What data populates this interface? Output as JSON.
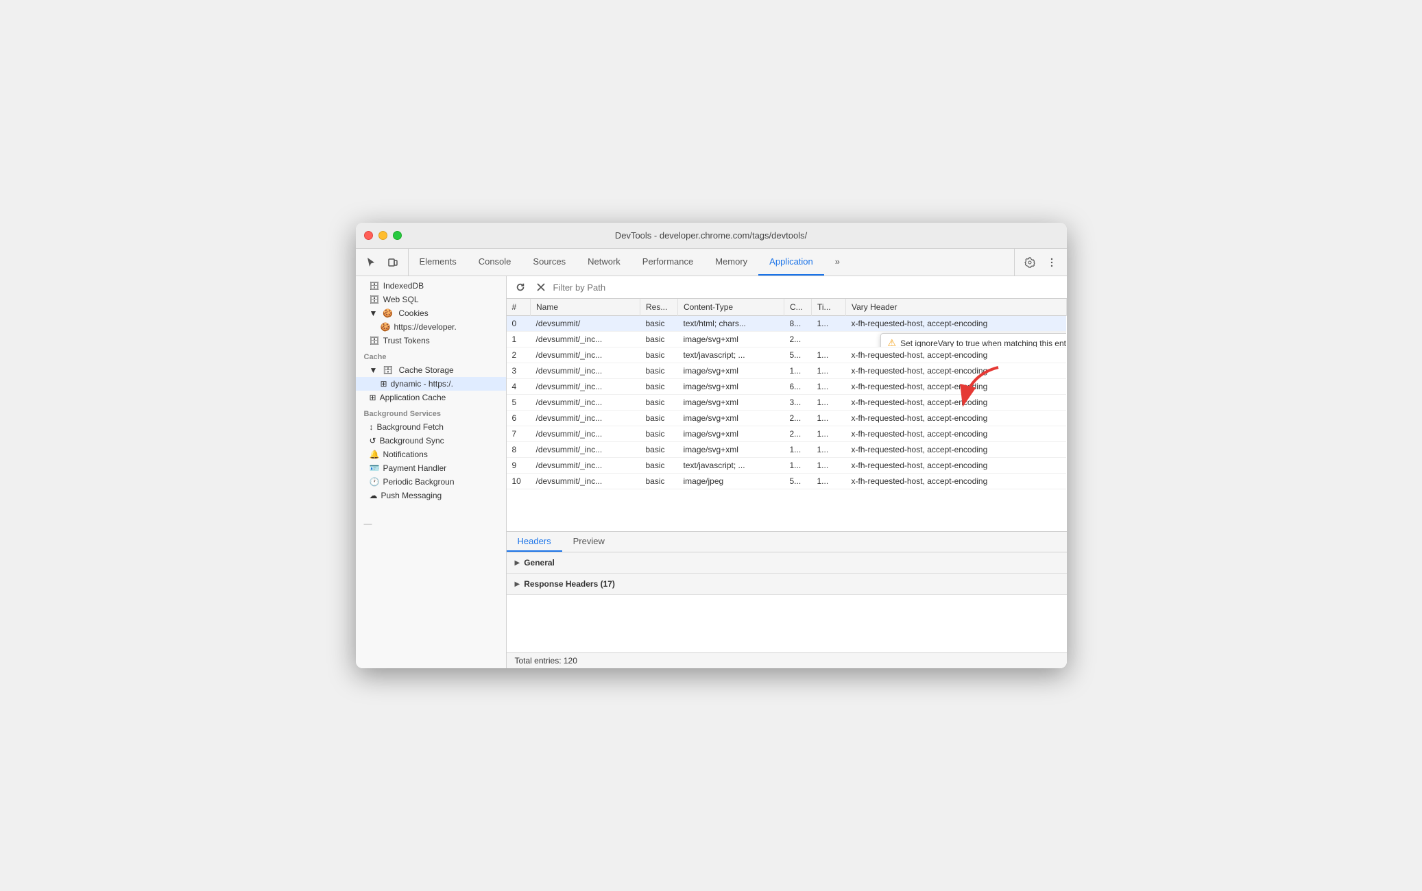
{
  "window": {
    "title": "DevTools - developer.chrome.com/tags/devtools/"
  },
  "tabs": [
    {
      "id": "elements",
      "label": "Elements",
      "active": false
    },
    {
      "id": "console",
      "label": "Console",
      "active": false
    },
    {
      "id": "sources",
      "label": "Sources",
      "active": false
    },
    {
      "id": "network",
      "label": "Network",
      "active": false
    },
    {
      "id": "performance",
      "label": "Performance",
      "active": false
    },
    {
      "id": "memory",
      "label": "Memory",
      "active": false
    },
    {
      "id": "application",
      "label": "Application",
      "active": true
    }
  ],
  "more_tabs_label": "»",
  "sidebar": {
    "items": [
      {
        "id": "indexeddb",
        "label": "IndexedDB",
        "icon": "🗄",
        "indent": 1
      },
      {
        "id": "websql",
        "label": "Web SQL",
        "icon": "🗄",
        "indent": 1
      },
      {
        "id": "cookies-header",
        "label": "Cookies",
        "icon": "▼ 🍪",
        "indent": 1,
        "expanded": true
      },
      {
        "id": "cookies-url",
        "label": "https://developer.",
        "icon": "🍪",
        "indent": 2
      },
      {
        "id": "trust-tokens",
        "label": "Trust Tokens",
        "icon": "🗄",
        "indent": 1
      },
      {
        "id": "cache-section",
        "label": "Cache",
        "section": true
      },
      {
        "id": "cache-storage-header",
        "label": "Cache Storage",
        "icon": "▼ 🗄",
        "indent": 1,
        "expanded": true
      },
      {
        "id": "dynamic-cache",
        "label": "dynamic - https:/.",
        "icon": "⊞",
        "indent": 2,
        "selected": true
      },
      {
        "id": "app-cache",
        "label": "Application Cache",
        "icon": "⊞",
        "indent": 1
      },
      {
        "id": "bg-services-section",
        "label": "Background Services",
        "section": true
      },
      {
        "id": "bg-fetch",
        "label": "Background Fetch",
        "icon": "↕",
        "indent": 1
      },
      {
        "id": "bg-sync",
        "label": "Background Sync",
        "icon": "↺",
        "indent": 1
      },
      {
        "id": "notifications",
        "label": "Notifications",
        "icon": "🔔",
        "indent": 1
      },
      {
        "id": "payment-handler",
        "label": "Payment Handler",
        "icon": "🪪",
        "indent": 1
      },
      {
        "id": "periodic-bg",
        "label": "Periodic Backgroun",
        "icon": "🕐",
        "indent": 1
      },
      {
        "id": "push-messaging",
        "label": "Push Messaging",
        "icon": "☁",
        "indent": 1
      }
    ]
  },
  "filter": {
    "placeholder": "Filter by Path"
  },
  "table": {
    "columns": [
      "#",
      "Name",
      "Res...",
      "Content-Type",
      "C...",
      "Ti...",
      "Vary Header"
    ],
    "rows": [
      {
        "hash": "0",
        "name": "/devsummit/",
        "res": "basic",
        "ct": "text/html; chars...",
        "c": "8...",
        "ti": "1...",
        "vary": "x-fh-requested-host, accept-encoding",
        "selected": true
      },
      {
        "hash": "1",
        "name": "/devsummit/_inc...",
        "res": "basic",
        "ct": "image/svg+xml",
        "c": "2...",
        "ti": "",
        "vary": "",
        "tooltip": true
      },
      {
        "hash": "2",
        "name": "/devsummit/_inc...",
        "res": "basic",
        "ct": "text/javascript; ...",
        "c": "5...",
        "ti": "1...",
        "vary": "x-fh-requested-host, accept-encoding"
      },
      {
        "hash": "3",
        "name": "/devsummit/_inc...",
        "res": "basic",
        "ct": "image/svg+xml",
        "c": "1...",
        "ti": "1...",
        "vary": "x-fh-requested-host, accept-encoding"
      },
      {
        "hash": "4",
        "name": "/devsummit/_inc...",
        "res": "basic",
        "ct": "image/svg+xml",
        "c": "6...",
        "ti": "1...",
        "vary": "x-fh-requested-host, accept-encoding"
      },
      {
        "hash": "5",
        "name": "/devsummit/_inc...",
        "res": "basic",
        "ct": "image/svg+xml",
        "c": "3...",
        "ti": "1...",
        "vary": "x-fh-requested-host, accept-encoding"
      },
      {
        "hash": "6",
        "name": "/devsummit/_inc...",
        "res": "basic",
        "ct": "image/svg+xml",
        "c": "2...",
        "ti": "1...",
        "vary": "x-fh-requested-host, accept-encoding"
      },
      {
        "hash": "7",
        "name": "/devsummit/_inc...",
        "res": "basic",
        "ct": "image/svg+xml",
        "c": "2...",
        "ti": "1...",
        "vary": "x-fh-requested-host, accept-encoding"
      },
      {
        "hash": "8",
        "name": "/devsummit/_inc...",
        "res": "basic",
        "ct": "image/svg+xml",
        "c": "1...",
        "ti": "1...",
        "vary": "x-fh-requested-host, accept-encoding"
      },
      {
        "hash": "9",
        "name": "/devsummit/_inc...",
        "res": "basic",
        "ct": "text/javascript; ...",
        "c": "1...",
        "ti": "1...",
        "vary": "x-fh-requested-host, accept-encoding"
      },
      {
        "hash": "10",
        "name": "/devsummit/_inc...",
        "res": "basic",
        "ct": "image/jpeg",
        "c": "5...",
        "ti": "1...",
        "vary": "x-fh-requested-host, accept-encoding"
      }
    ],
    "tooltip_text": "Set ignoreVary to true when matching this entry"
  },
  "bottom_panel": {
    "tabs": [
      {
        "label": "Headers",
        "active": true
      },
      {
        "label": "Preview",
        "active": false
      }
    ],
    "sections": [
      {
        "label": "General",
        "expanded": false
      },
      {
        "label": "Response Headers (17)",
        "expanded": false
      }
    ],
    "status": "Total entries: 120"
  }
}
